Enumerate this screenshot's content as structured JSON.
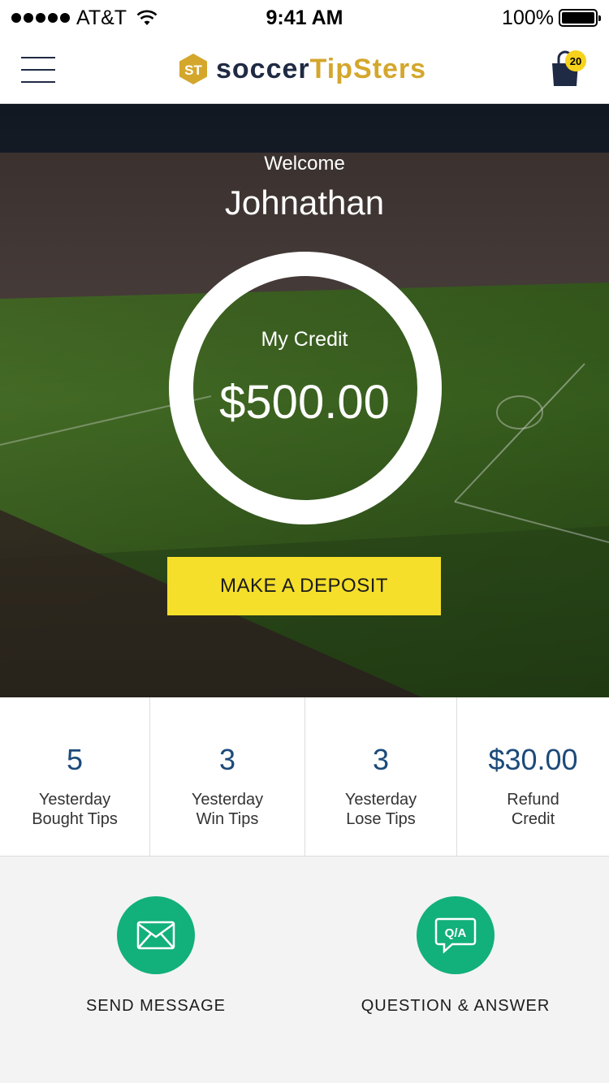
{
  "status_bar": {
    "carrier": "AT&T",
    "time": "9:41 AM",
    "battery": "100%"
  },
  "nav": {
    "logo_part_1": "soccer",
    "logo_part_2": "TipSters",
    "cart_count": "20"
  },
  "hero": {
    "welcome": "Welcome",
    "username": "Johnathan",
    "credit_label": "My Credit",
    "credit_value": "$500.00",
    "deposit_button": "MAKE A DEPOSIT"
  },
  "stats": [
    {
      "value": "5",
      "line1": "Yesterday",
      "line2": "Bought Tips"
    },
    {
      "value": "3",
      "line1": "Yesterday",
      "line2": "Win Tips"
    },
    {
      "value": "3",
      "line1": "Yesterday",
      "line2": "Lose Tips"
    },
    {
      "value": "$30.00",
      "line1": "Refund",
      "line2": "Credit"
    }
  ],
  "actions": {
    "send_message": "SEND MESSAGE",
    "qa_icon_text": "Q/A",
    "question_answer": "QUESTION & ANSWER"
  },
  "colors": {
    "accent_yellow": "#f5df2a",
    "accent_green": "#12b07a",
    "value_blue": "#1c4a7a",
    "logo_navy": "#1f2a44",
    "logo_gold": "#d4a72c"
  },
  "icons": {
    "menu": "hamburger-icon",
    "cart": "shopping-bag-icon",
    "message": "envelope-icon",
    "qa": "speech-bubble-icon"
  }
}
